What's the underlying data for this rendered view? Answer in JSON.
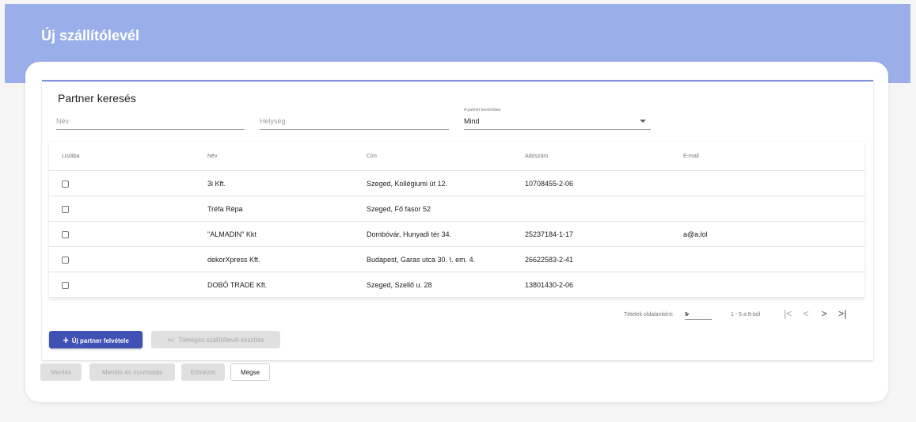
{
  "page": {
    "title": "Új szállítólevél"
  },
  "search": {
    "title": "Partner keresés",
    "name_placeholder": "Név",
    "city_placeholder": "Helység",
    "rating_label": "A partner besorolása",
    "rating_value": "Mind"
  },
  "table": {
    "columns": [
      "Listába",
      "Név",
      "Cím",
      "Adószám",
      "E-mail"
    ],
    "rows": [
      {
        "name": "3i Kft.",
        "address": "Szeged, Kollégiumi út 12.",
        "tax": "10708455-2-06",
        "email": ""
      },
      {
        "name": "Tréfa Répa",
        "address": "Szeged, Fő fasor 52",
        "tax": "",
        "email": ""
      },
      {
        "name": "\"ALMADIN\" Kkt",
        "address": "Dombóvár, Hunyadi tér 34.",
        "tax": "25237184-1-17",
        "email": "a@a.lol"
      },
      {
        "name": "dekorXpress Kft.",
        "address": "Budapest, Garas utca 30. I. em. 4.",
        "tax": "26622583-2-41",
        "email": ""
      },
      {
        "name": "DOBÓ TRADE Kft.",
        "address": "Szeged, Szellő u. 28",
        "tax": "13801430-2-06",
        "email": ""
      }
    ]
  },
  "paginator": {
    "items_per_page_label": "Tételek oldalanként:",
    "page_size": "5",
    "range": "1 - 5 a 8-ból",
    "first_icon": "first-page-icon",
    "prev_icon": "chevron-left-icon",
    "next_icon": "chevron-right-icon",
    "last_icon": "last-page-icon"
  },
  "actions": {
    "new_partner": "Új partner felvétele",
    "bulk": "Tömeges szállítólevél készítés"
  },
  "footer": {
    "save": "Mentés",
    "save_print": "Mentés és nyomtatás",
    "preview": "Előnézet",
    "cancel": "Mégse"
  },
  "colors": {
    "header": "#9aaee9",
    "primary": "#3f51b5",
    "accent_line": "#7d90dd"
  }
}
